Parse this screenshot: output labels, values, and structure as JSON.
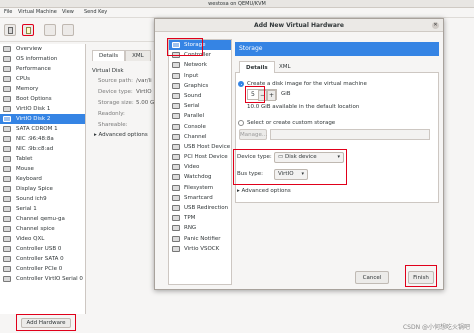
{
  "bg_window": {
    "title": "westosa on QEMU/KVM"
  },
  "bg_menu": [
    "File",
    "Virtual Machine",
    "View",
    "Send Key"
  ],
  "left_list": {
    "items": [
      "Overview",
      "OS information",
      "Performance",
      "CPUs",
      "Memory",
      "Boot Options",
      "VirtIO Disk 1",
      "VirtIO Disk 2",
      "SATA CDROM 1",
      "NIC :96:48:8a",
      "NIC :9b:c8:ad",
      "Tablet",
      "Mouse",
      "Keyboard",
      "Display Spice",
      "Sound ich9",
      "Serial 1",
      "Channel qemu-ga",
      "Channel spice",
      "Video QXL",
      "Controller USB 0",
      "Controller SATA 0",
      "Controller PCIe 0",
      "Controller VirtIO Serial 0"
    ],
    "selected_index": 7
  },
  "add_hardware_label": "Add Hardware",
  "bg_details": {
    "tabs": [
      "Details",
      "XML"
    ],
    "heading": "Virtual Disk",
    "fields": [
      {
        "label": "Source path:",
        "value": "/var/li"
      },
      {
        "label": "Device type:",
        "value": "VirtIO"
      },
      {
        "label": "Storage size:",
        "value": "5.00 G"
      },
      {
        "label": "Readonly:",
        "value": ""
      },
      {
        "label": "Shareable:",
        "value": ""
      }
    ],
    "advanced": "Advanced options"
  },
  "dialog": {
    "title": "Add New Virtual Hardware",
    "hardware_list": {
      "items": [
        "Storage",
        "Controller",
        "Network",
        "Input",
        "Graphics",
        "Sound",
        "Serial",
        "Parallel",
        "Console",
        "Channel",
        "USB Host Device",
        "PCI Host Device",
        "Video",
        "Watchdog",
        "Filesystem",
        "Smartcard",
        "USB Redirection",
        "TPM",
        "RNG",
        "Panic Notifier",
        "Virtio VSOCK"
      ],
      "selected_index": 0
    },
    "pane_header": "Storage",
    "tabs": [
      "Details",
      "XML"
    ],
    "create_disk_label": "Create a disk image for the virtual machine",
    "disk_size": "5",
    "disk_unit": "GiB",
    "available_text": "10.0 GiB available in the default location",
    "custom_storage_label": "Select or create custom storage",
    "manage_label": "Manage...",
    "device_type_label": "Device type:",
    "device_type_value": "Disk device",
    "bus_type_label": "Bus type:",
    "bus_type_value": "VirtIO",
    "advanced_label": "Advanced options",
    "cancel_label": "Cancel",
    "finish_label": "Finish"
  },
  "watermark": "CSDN @小何想吃火锅吧"
}
